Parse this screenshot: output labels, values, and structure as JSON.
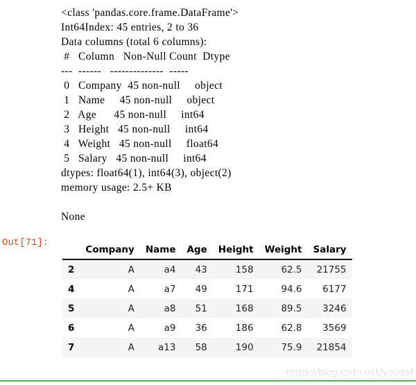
{
  "stdout": {
    "lines": [
      "<class 'pandas.core.frame.DataFrame'>",
      "Int64Index: 45 entries, 2 to 36",
      "Data columns (total 6 columns):",
      " #   Column   Non-Null Count  Dtype",
      "---  ------   --------------  -----",
      " 0   Company  45 non-null     object",
      " 1   Name     45 non-null     object",
      " 2   Age      45 non-null     int64",
      " 3   Height   45 non-null     int64",
      " 4   Weight   45 non-null     float64",
      " 5   Salary   45 non-null     int64",
      "dtypes: float64(1), int64(3), object(2)",
      "memory usage: 2.5+ KB",
      "",
      "None"
    ]
  },
  "prompt": {
    "out_label": "Out[71]:",
    "color": "#D84315"
  },
  "dataframe": {
    "index_header": "",
    "columns": [
      "Company",
      "Name",
      "Age",
      "Height",
      "Weight",
      "Salary"
    ],
    "index": [
      "2",
      "4",
      "5",
      "6",
      "7"
    ],
    "rows": [
      [
        "A",
        "a4",
        "43",
        "158",
        "62.5",
        "21755"
      ],
      [
        "A",
        "a7",
        "49",
        "171",
        "94.6",
        "6177"
      ],
      [
        "A",
        "a8",
        "51",
        "168",
        "89.5",
        "3246"
      ],
      [
        "A",
        "a9",
        "36",
        "186",
        "62.8",
        "3569"
      ],
      [
        "A",
        "a13",
        "58",
        "190",
        "75.9",
        "21854"
      ]
    ]
  },
  "watermark": {
    "text": "https://blog.csdn.net/youdef",
    "color": "#e2e2e2"
  },
  "bottom_rule": {
    "color": "#5aab68"
  }
}
